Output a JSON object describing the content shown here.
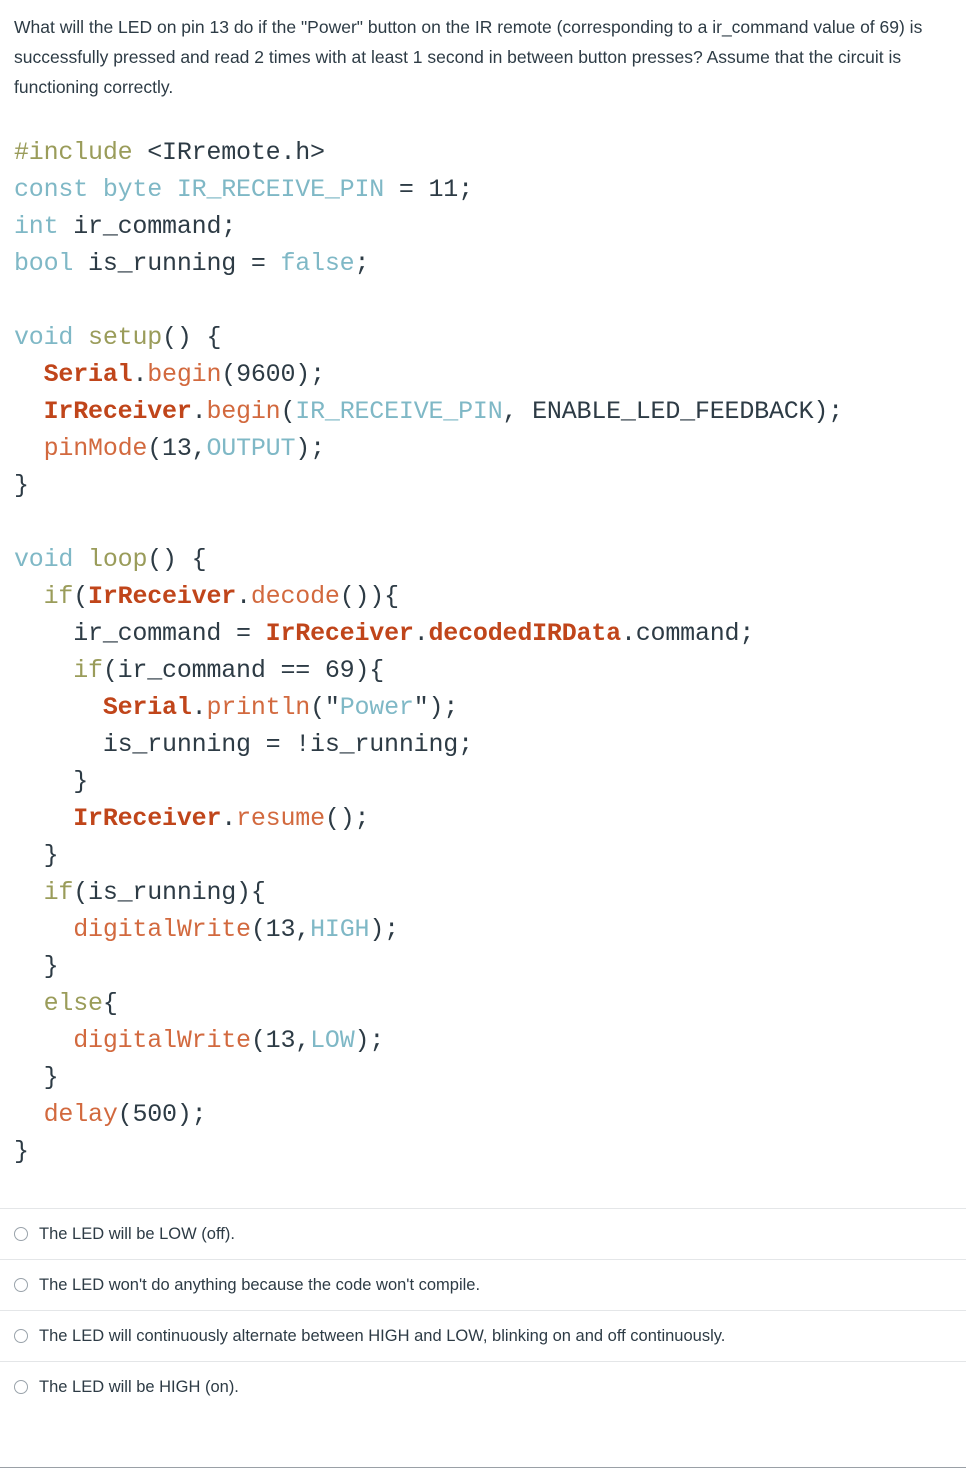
{
  "question": {
    "text": "What will the LED on pin 13 do if the \"Power\" button on the IR remote (corresponding to a ir_command value of 69) is successfully pressed and read 2 times with at least 1 second in between button presses? Assume that the circuit is functioning correctly."
  },
  "code": {
    "language": "arduino-cpp",
    "lines": [
      {
        "tokens": [
          {
            "t": "#include",
            "c": "pre"
          },
          {
            "t": " <IRremote.h>",
            "c": "plain"
          }
        ]
      },
      {
        "tokens": [
          {
            "t": "const byte",
            "c": "kw"
          },
          {
            "t": " ",
            "c": "plain"
          },
          {
            "t": "IR_RECEIVE_PIN",
            "c": "const"
          },
          {
            "t": " = ",
            "c": "plain"
          },
          {
            "t": "11",
            "c": "plain"
          },
          {
            "t": ";",
            "c": "plain"
          }
        ]
      },
      {
        "tokens": [
          {
            "t": "int",
            "c": "kw"
          },
          {
            "t": " ir_command;",
            "c": "plain"
          }
        ]
      },
      {
        "tokens": [
          {
            "t": "bool",
            "c": "kw"
          },
          {
            "t": " is_running = ",
            "c": "plain"
          },
          {
            "t": "false",
            "c": "const"
          },
          {
            "t": ";",
            "c": "plain"
          }
        ]
      },
      {
        "tokens": []
      },
      {
        "tokens": [
          {
            "t": "void",
            "c": "kw"
          },
          {
            "t": " ",
            "c": "plain"
          },
          {
            "t": "setup",
            "c": "ctl"
          },
          {
            "t": "() {",
            "c": "plain"
          }
        ]
      },
      {
        "tokens": [
          {
            "t": "  ",
            "c": "plain"
          },
          {
            "t": "Serial",
            "c": "obj"
          },
          {
            "t": ".",
            "c": "plain"
          },
          {
            "t": "begin",
            "c": "fn"
          },
          {
            "t": "(",
            "c": "plain"
          },
          {
            "t": "9600",
            "c": "plain"
          },
          {
            "t": ");",
            "c": "plain"
          }
        ]
      },
      {
        "tokens": [
          {
            "t": "  ",
            "c": "plain"
          },
          {
            "t": "IrReceiver",
            "c": "obj"
          },
          {
            "t": ".",
            "c": "plain"
          },
          {
            "t": "begin",
            "c": "fn"
          },
          {
            "t": "(",
            "c": "plain"
          },
          {
            "t": "IR_RECEIVE_PIN",
            "c": "const"
          },
          {
            "t": ", ENABLE_LED_FEEDBACK);",
            "c": "plain"
          }
        ]
      },
      {
        "tokens": [
          {
            "t": "  ",
            "c": "plain"
          },
          {
            "t": "pinMode",
            "c": "fn"
          },
          {
            "t": "(",
            "c": "plain"
          },
          {
            "t": "13",
            "c": "plain"
          },
          {
            "t": ",",
            "c": "plain"
          },
          {
            "t": "OUTPUT",
            "c": "const"
          },
          {
            "t": ");",
            "c": "plain"
          }
        ]
      },
      {
        "tokens": [
          {
            "t": "}",
            "c": "plain"
          }
        ]
      },
      {
        "tokens": []
      },
      {
        "tokens": [
          {
            "t": "void",
            "c": "kw"
          },
          {
            "t": " ",
            "c": "plain"
          },
          {
            "t": "loop",
            "c": "ctl"
          },
          {
            "t": "() {",
            "c": "plain"
          }
        ]
      },
      {
        "tokens": [
          {
            "t": "  ",
            "c": "plain"
          },
          {
            "t": "if",
            "c": "ctl"
          },
          {
            "t": "(",
            "c": "plain"
          },
          {
            "t": "IrReceiver",
            "c": "obj"
          },
          {
            "t": ".",
            "c": "plain"
          },
          {
            "t": "decode",
            "c": "fn"
          },
          {
            "t": "()){",
            "c": "plain"
          }
        ]
      },
      {
        "tokens": [
          {
            "t": "    ir_command = ",
            "c": "plain"
          },
          {
            "t": "IrReceiver",
            "c": "obj"
          },
          {
            "t": ".",
            "c": "plain"
          },
          {
            "t": "decodedIRData",
            "c": "obj"
          },
          {
            "t": ".command;",
            "c": "plain"
          }
        ]
      },
      {
        "tokens": [
          {
            "t": "    ",
            "c": "plain"
          },
          {
            "t": "if",
            "c": "ctl"
          },
          {
            "t": "(ir_command == ",
            "c": "plain"
          },
          {
            "t": "69",
            "c": "plain"
          },
          {
            "t": "){",
            "c": "plain"
          }
        ]
      },
      {
        "tokens": [
          {
            "t": "      ",
            "c": "plain"
          },
          {
            "t": "Serial",
            "c": "obj"
          },
          {
            "t": ".",
            "c": "plain"
          },
          {
            "t": "println",
            "c": "fn"
          },
          {
            "t": "(\"",
            "c": "plain"
          },
          {
            "t": "Power",
            "c": "str"
          },
          {
            "t": "\");",
            "c": "plain"
          }
        ]
      },
      {
        "tokens": [
          {
            "t": "      is_running = !is_running;",
            "c": "plain"
          }
        ]
      },
      {
        "tokens": [
          {
            "t": "    }",
            "c": "plain"
          }
        ]
      },
      {
        "tokens": [
          {
            "t": "    ",
            "c": "plain"
          },
          {
            "t": "IrReceiver",
            "c": "obj"
          },
          {
            "t": ".",
            "c": "plain"
          },
          {
            "t": "resume",
            "c": "fn"
          },
          {
            "t": "();",
            "c": "plain"
          }
        ]
      },
      {
        "tokens": [
          {
            "t": "  }",
            "c": "plain"
          }
        ]
      },
      {
        "tokens": [
          {
            "t": "  ",
            "c": "plain"
          },
          {
            "t": "if",
            "c": "ctl"
          },
          {
            "t": "(is_running){",
            "c": "plain"
          }
        ]
      },
      {
        "tokens": [
          {
            "t": "    ",
            "c": "plain"
          },
          {
            "t": "digitalWrite",
            "c": "fn"
          },
          {
            "t": "(",
            "c": "plain"
          },
          {
            "t": "13",
            "c": "plain"
          },
          {
            "t": ",",
            "c": "plain"
          },
          {
            "t": "HIGH",
            "c": "const"
          },
          {
            "t": ");",
            "c": "plain"
          }
        ]
      },
      {
        "tokens": [
          {
            "t": "  }",
            "c": "plain"
          }
        ]
      },
      {
        "tokens": [
          {
            "t": "  ",
            "c": "plain"
          },
          {
            "t": "else",
            "c": "ctl"
          },
          {
            "t": "{",
            "c": "plain"
          }
        ]
      },
      {
        "tokens": [
          {
            "t": "    ",
            "c": "plain"
          },
          {
            "t": "digitalWrite",
            "c": "fn"
          },
          {
            "t": "(",
            "c": "plain"
          },
          {
            "t": "13",
            "c": "plain"
          },
          {
            "t": ",",
            "c": "plain"
          },
          {
            "t": "LOW",
            "c": "const"
          },
          {
            "t": ");",
            "c": "plain"
          }
        ]
      },
      {
        "tokens": [
          {
            "t": "  }",
            "c": "plain"
          }
        ]
      },
      {
        "tokens": [
          {
            "t": "  ",
            "c": "plain"
          },
          {
            "t": "delay",
            "c": "fn"
          },
          {
            "t": "(",
            "c": "plain"
          },
          {
            "t": "500",
            "c": "plain"
          },
          {
            "t": ");",
            "c": "plain"
          }
        ]
      },
      {
        "tokens": [
          {
            "t": "}",
            "c": "plain"
          }
        ]
      }
    ]
  },
  "answers": {
    "selected": null,
    "options": [
      {
        "label": "The LED will be LOW (off).",
        "selected": false
      },
      {
        "label": "The LED won't do anything because the code won't compile.",
        "selected": false
      },
      {
        "label": "The LED will continuously alternate between HIGH and LOW, blinking on and off continuously.",
        "selected": false
      },
      {
        "label": "The LED will be HIGH (on).",
        "selected": false
      }
    ]
  },
  "colors": {
    "text": "#2d3b45",
    "keyword": "#7fb8c6",
    "preprocessor": "#9a9c5a",
    "control": "#9a9c5a",
    "object": "#c0451a",
    "function": "#d2693e",
    "string": "#7fb8c6",
    "divider": "#e4e6e8",
    "radio_border": "#9aa3ab"
  }
}
